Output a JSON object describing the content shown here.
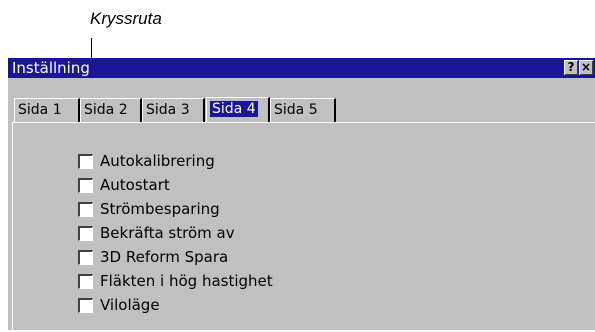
{
  "callout": {
    "label": "Kryssruta"
  },
  "window": {
    "title": "Inställning",
    "help_glyph": "?",
    "close_glyph": "×"
  },
  "tabs": [
    {
      "label": "Sida 1",
      "active": false
    },
    {
      "label": "Sida 2",
      "active": false
    },
    {
      "label": "Sida 3",
      "active": false
    },
    {
      "label": "Sida 4",
      "active": true
    },
    {
      "label": "Sida 5",
      "active": false
    }
  ],
  "options": [
    {
      "label": "Autokalibrering",
      "checked": false
    },
    {
      "label": "Autostart",
      "checked": false
    },
    {
      "label": "Strömbesparing",
      "checked": false
    },
    {
      "label": "Bekräfta ström av",
      "checked": false
    },
    {
      "label": "3D Reform Spara",
      "checked": false
    },
    {
      "label": "Fläkten i hög hastighet",
      "checked": false
    },
    {
      "label": "Viloläge",
      "checked": false
    }
  ],
  "colors": {
    "titlebar": "#1a1699",
    "window": "#c0c0c0",
    "active_tab_text": "#ffffff"
  }
}
